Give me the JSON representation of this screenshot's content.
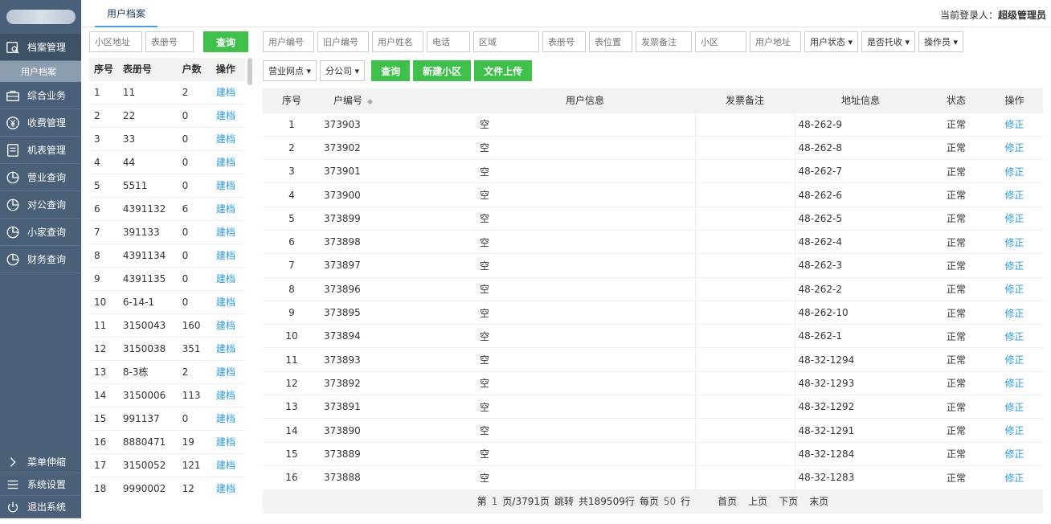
{
  "sidebar": {
    "menu": [
      {
        "label": "档案管理",
        "icon": "archive-icon"
      },
      {
        "label": "综合业务",
        "icon": "briefcase-icon"
      },
      {
        "label": "收费管理",
        "icon": "yuan-coin-icon"
      },
      {
        "label": "机表管理",
        "icon": "meter-icon"
      },
      {
        "label": "营业查询",
        "icon": "pie-chart-icon"
      },
      {
        "label": "对公查询",
        "icon": "pie-chart-icon"
      },
      {
        "label": "小家查询",
        "icon": "pie-chart-icon"
      },
      {
        "label": "财务查询",
        "icon": "pie-chart-icon"
      }
    ],
    "sub_item": "用户档案",
    "bottom": [
      {
        "label": "菜单伸缩",
        "icon": "chevron-right-icon"
      },
      {
        "label": "系统设置",
        "icon": "hamburger-icon"
      },
      {
        "label": "退出系统",
        "icon": "power-icon"
      }
    ]
  },
  "header": {
    "tab": "用户档案",
    "login_label": "当前登录人：",
    "login_user": "超级管理员"
  },
  "left": {
    "filters": {
      "area_placeholder": "小区地址",
      "book_placeholder": "表册号",
      "query_label": "查询"
    },
    "columns": [
      "序号",
      "表册号",
      "户数",
      "操作"
    ],
    "rows": [
      {
        "no": "1",
        "book": "11",
        "count": "2",
        "op": "建档"
      },
      {
        "no": "2",
        "book": "22",
        "count": "0",
        "op": "建档"
      },
      {
        "no": "3",
        "book": "33",
        "count": "0",
        "op": "建档"
      },
      {
        "no": "4",
        "book": "44",
        "count": "0",
        "op": "建档"
      },
      {
        "no": "5",
        "book": "5511",
        "count": "0",
        "op": "建档"
      },
      {
        "no": "6",
        "book": "4391132",
        "count": "6",
        "op": "建档"
      },
      {
        "no": "7",
        "book": "391133",
        "count": "0",
        "op": "建档"
      },
      {
        "no": "8",
        "book": "4391134",
        "count": "0",
        "op": "建档"
      },
      {
        "no": "9",
        "book": "4391135",
        "count": "0",
        "op": "建档"
      },
      {
        "no": "10",
        "book": "6-14-1",
        "count": "0",
        "op": "建档"
      },
      {
        "no": "11",
        "book": "3150043",
        "count": "160",
        "op": "建档"
      },
      {
        "no": "12",
        "book": "3150038",
        "count": "351",
        "op": "建档"
      },
      {
        "no": "13",
        "book": "8-3栋",
        "count": "2",
        "op": "建档"
      },
      {
        "no": "14",
        "book": "3150006",
        "count": "113",
        "op": "建档"
      },
      {
        "no": "15",
        "book": "991137",
        "count": "0",
        "op": "建档"
      },
      {
        "no": "16",
        "book": "8880471",
        "count": "19",
        "op": "建档"
      },
      {
        "no": "17",
        "book": "3150052",
        "count": "121",
        "op": "建档"
      },
      {
        "no": "18",
        "book": "9990002",
        "count": "12",
        "op": "建档"
      }
    ]
  },
  "right": {
    "filters_row1": {
      "inputs": [
        "用户编号",
        "旧户编号",
        "用户姓名",
        "电话",
        "区域",
        "表册号",
        "表位置",
        "发票备注",
        "小区",
        "用户地址"
      ],
      "dropdowns": [
        "用户状态",
        "是否托收",
        "操作员"
      ]
    },
    "filters_row2": {
      "dropdowns": [
        "营业网点",
        "分公司"
      ],
      "buttons": [
        "查询",
        "新建小区",
        "文件上传"
      ]
    },
    "columns": [
      "序号",
      "户编号",
      "用户信息",
      "发票备注",
      "地址信息",
      "状态",
      "操作"
    ],
    "rows": [
      {
        "no": "1",
        "id": "373903",
        "info": "空",
        "note": "",
        "addr": "48-262-9",
        "status": "正常",
        "op": "修正"
      },
      {
        "no": "2",
        "id": "373902",
        "info": "空",
        "note": "",
        "addr": "48-262-8",
        "status": "正常",
        "op": "修正"
      },
      {
        "no": "3",
        "id": "373901",
        "info": "空",
        "note": "",
        "addr": "48-262-7",
        "status": "正常",
        "op": "修正"
      },
      {
        "no": "4",
        "id": "373900",
        "info": "空",
        "note": "",
        "addr": "48-262-6",
        "status": "正常",
        "op": "修正"
      },
      {
        "no": "5",
        "id": "373899",
        "info": "空",
        "note": "",
        "addr": "48-262-5",
        "status": "正常",
        "op": "修正"
      },
      {
        "no": "6",
        "id": "373898",
        "info": "空",
        "note": "",
        "addr": "48-262-4",
        "status": "正常",
        "op": "修正"
      },
      {
        "no": "7",
        "id": "373897",
        "info": "空",
        "note": "",
        "addr": "48-262-3",
        "status": "正常",
        "op": "修正"
      },
      {
        "no": "8",
        "id": "373896",
        "info": "空",
        "note": "",
        "addr": "48-262-2",
        "status": "正常",
        "op": "修正"
      },
      {
        "no": "9",
        "id": "373895",
        "info": "空",
        "note": "",
        "addr": "48-262-10",
        "status": "正常",
        "op": "修正"
      },
      {
        "no": "10",
        "id": "373894",
        "info": "空",
        "note": "",
        "addr": "48-262-1",
        "status": "正常",
        "op": "修正"
      },
      {
        "no": "11",
        "id": "373893",
        "info": "空",
        "note": "",
        "addr": "48-32-1294",
        "status": "正常",
        "op": "修正"
      },
      {
        "no": "12",
        "id": "373892",
        "info": "空",
        "note": "",
        "addr": "48-32-1293",
        "status": "正常",
        "op": "修正"
      },
      {
        "no": "13",
        "id": "373891",
        "info": "空",
        "note": "",
        "addr": "48-32-1292",
        "status": "正常",
        "op": "修正"
      },
      {
        "no": "14",
        "id": "373890",
        "info": "空",
        "note": "",
        "addr": "48-32-1291",
        "status": "正常",
        "op": "修正"
      },
      {
        "no": "15",
        "id": "373889",
        "info": "空",
        "note": "",
        "addr": "48-32-1284",
        "status": "正常",
        "op": "修正"
      },
      {
        "no": "16",
        "id": "373888",
        "info": "空",
        "note": "",
        "addr": "48-32-1283",
        "status": "正常",
        "op": "修正"
      }
    ],
    "pager": {
      "page_prefix": "第",
      "page_current": "1",
      "page_total": "页/3791页",
      "jump": "跳转",
      "total": "共189509行",
      "per_page_label": "每页",
      "per_page": "50",
      "rows_suffix": "行",
      "first": "首页",
      "prev": "上页",
      "next": "下页",
      "last": "末页"
    }
  },
  "colors": {
    "sidebar_bg": "#4a5f78",
    "accent_green": "#3ec04a",
    "link_blue": "#2b9be0"
  }
}
